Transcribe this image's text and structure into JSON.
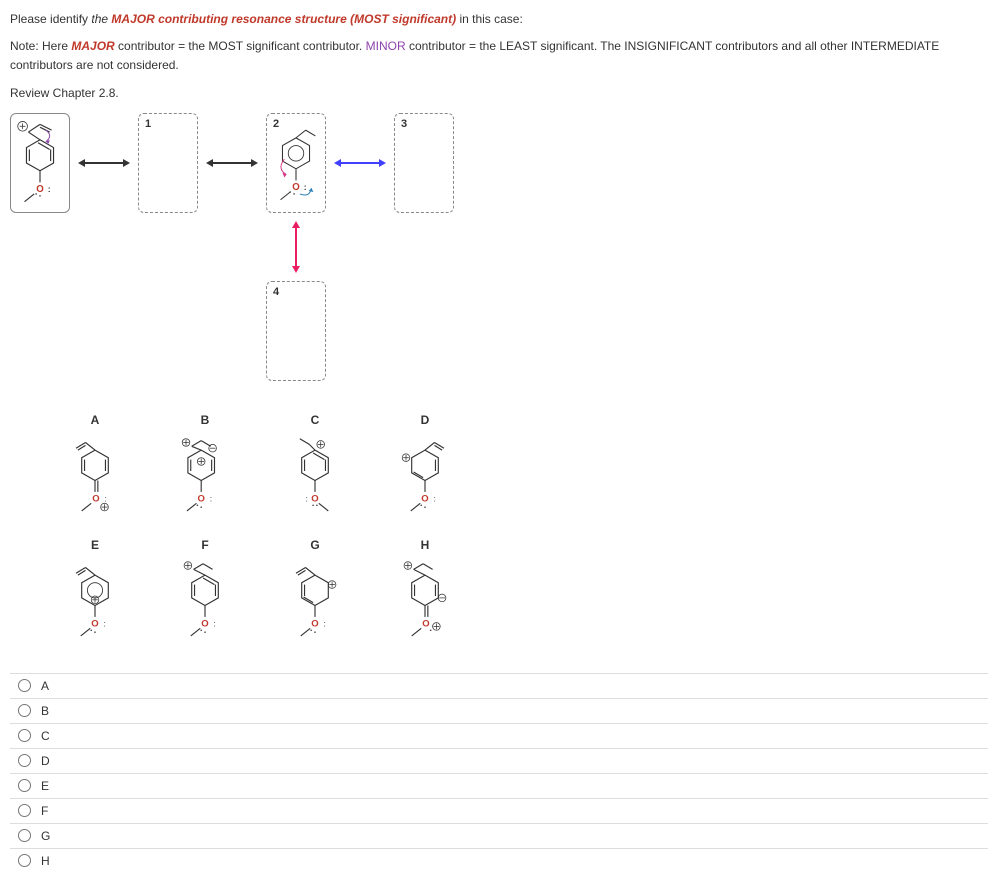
{
  "question": {
    "line1_prefix": "Please identify ",
    "line1_italic": "the ",
    "line1_major": "MAJOR",
    "line1_after_major": " contributing resonance structure (MOST significant)",
    "line1_suffix": " in this case:",
    "line2_prefix": "Note: Here ",
    "line2_major": "MAJOR",
    "line2_mid": " contributor = the MOST significant contributor. ",
    "line2_minor": "MINOR",
    "line2_suffix": " contributor = the LEAST significant. The INSIGNIFICANT contributors and all other INTERMEDIATE contributors are not considered.",
    "line3": "Review Chapter 2.8."
  },
  "diagram": {
    "box1": "1",
    "box2": "2",
    "box3": "3",
    "box4": "4"
  },
  "structures": {
    "row1": [
      {
        "label": "A"
      },
      {
        "label": "B"
      },
      {
        "label": "C"
      },
      {
        "label": "D"
      }
    ],
    "row2": [
      {
        "label": "E"
      },
      {
        "label": "F"
      },
      {
        "label": "G"
      },
      {
        "label": "H"
      }
    ]
  },
  "answers": [
    {
      "label": "A"
    },
    {
      "label": "B"
    },
    {
      "label": "C"
    },
    {
      "label": "D"
    },
    {
      "label": "E"
    },
    {
      "label": "F"
    },
    {
      "label": "G"
    },
    {
      "label": "H"
    }
  ],
  "atom": {
    "O": "O"
  }
}
